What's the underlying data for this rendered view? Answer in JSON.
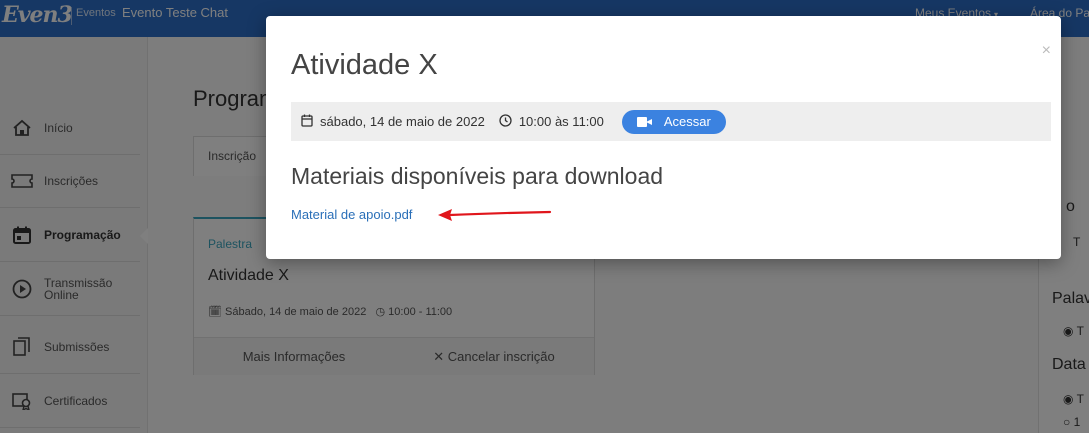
{
  "topbar": {
    "logo": "Even3",
    "eventos": "Eventos",
    "event_title": "Evento Teste Chat",
    "meus_eventos": "Meus Eventos",
    "caret": "▾",
    "area": "Área do Pa"
  },
  "sidebar": {
    "items": [
      {
        "label": "Início",
        "icon": "home-icon"
      },
      {
        "label": "Inscrições",
        "icon": "ticket-icon"
      },
      {
        "label": "Programação",
        "icon": "calendar-icon",
        "active": true
      },
      {
        "label": "Transmissão Online",
        "icon": "play-circle-icon"
      },
      {
        "label": "Submissões",
        "icon": "documents-icon"
      },
      {
        "label": "Certificados",
        "icon": "certificate-icon"
      }
    ]
  },
  "main": {
    "title": "Program",
    "tab": "Inscrição",
    "card": {
      "category": "Palestra",
      "title": "Atividade X",
      "date": "Sábado, 14 de maio de 2022",
      "time": "10:00 - 11:00",
      "more_label": "Mais Informações",
      "cancel_label": "Cancelar inscrição"
    }
  },
  "right_panel": {
    "frag1": "o",
    "frag2": "T",
    "palavras": "Palav",
    "frag3": "T",
    "data_label": "Data",
    "frag4": "T",
    "frag5": "1"
  },
  "modal": {
    "title": "Atividade X",
    "date": "sábado, 14 de maio de 2022",
    "time": "10:00 às 11:00",
    "access_label": "Acessar",
    "materials_heading": "Materiais disponíveis para download",
    "material_link": "Material de apoio.pdf",
    "close": "×"
  },
  "colors": {
    "topbar": "#2c6fc9",
    "accent_button": "#3b82e0",
    "link": "#2a6fb8",
    "annotation_arrow": "#e0161c"
  }
}
